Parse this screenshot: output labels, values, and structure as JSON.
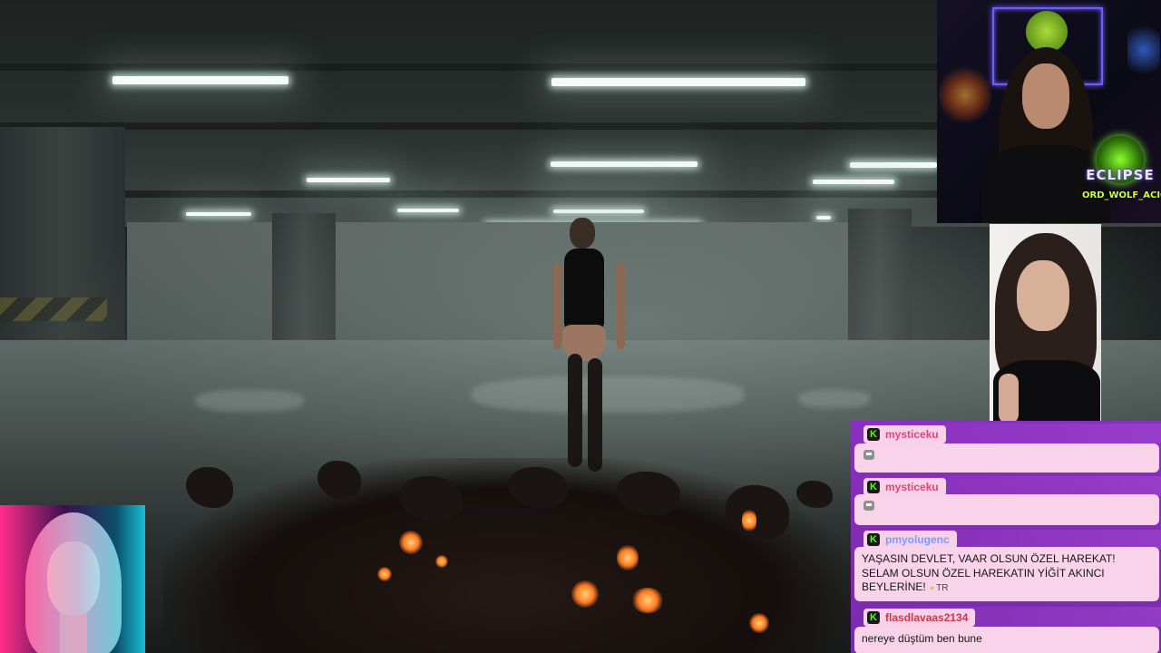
{
  "overlay": {
    "brand_logo": {
      "title": "ECLIPSE",
      "subtitle": "ORD_WOLF_ACION",
      "icon": "wolf-moon-icon"
    }
  },
  "chat": {
    "platform_badge": "K",
    "messages": [
      {
        "username": "mysticeku",
        "username_color": "#e0457b",
        "text": "",
        "emote": "pixel-cat-emote"
      },
      {
        "username": "mysticeku",
        "username_color": "#e0457b",
        "text": "",
        "emote": "pixel-cat-emote"
      },
      {
        "username": "pmyolugenc",
        "username_color": "#7f9bff",
        "text": "YAŞASIN DEVLET, VAAR OLSUN ÖZEL HAREKAT! SELAM OLSUN ÖZEL HAREKATIN YİĞİT AKINCI BEYLERİNE!",
        "flag": "TR"
      },
      {
        "username": "flasdlavaas2134",
        "username_color": "#d8334a",
        "text": "nereye düştüm ben bune"
      }
    ]
  },
  "colors": {
    "chat_background": "#7a2aae",
    "chat_bubble": "#f8d3ea",
    "kick_green": "#53fc18",
    "neon_green": "#8cff2a"
  }
}
